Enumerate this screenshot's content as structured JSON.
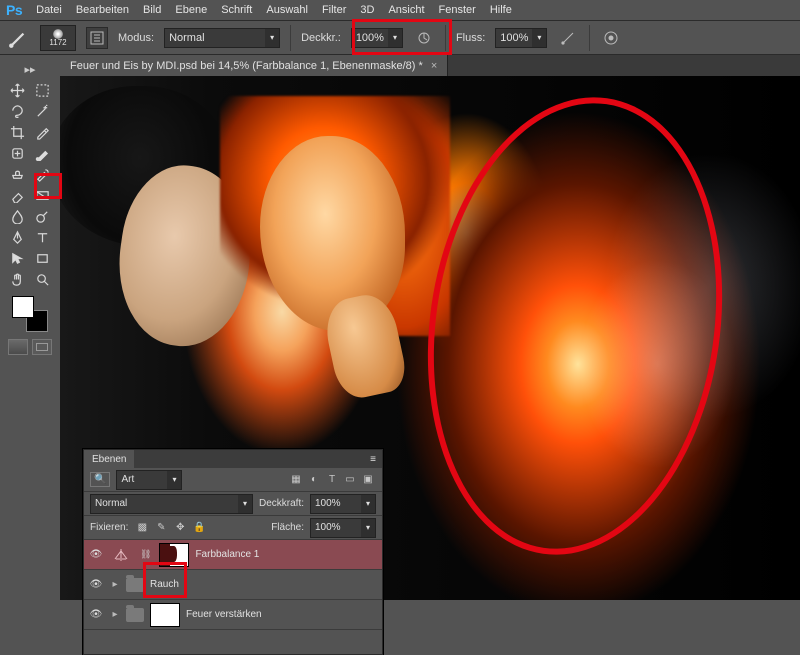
{
  "menu": {
    "items": [
      "Datei",
      "Bearbeiten",
      "Bild",
      "Ebene",
      "Schrift",
      "Auswahl",
      "Filter",
      "3D",
      "Ansicht",
      "Fenster",
      "Hilfe"
    ]
  },
  "options": {
    "brush_size": "1172",
    "mode_label": "Modus:",
    "mode_value": "Normal",
    "opacity_label": "Deckkr.:",
    "opacity_value": "100%",
    "flow_label": "Fluss:",
    "flow_value": "100%"
  },
  "document": {
    "tab_title": "Feuer und Eis by MDI.psd bei 14,5% (Farbbalance 1, Ebenenmaske/8) *"
  },
  "layers_panel": {
    "tab": "Ebenen",
    "filter_label": "Art",
    "blend_mode": "Normal",
    "opacity_label": "Deckkraft:",
    "opacity_value": "100%",
    "lock_label": "Fixieren:",
    "fill_label": "Fläche:",
    "fill_value": "100%",
    "layers": [
      {
        "name": "Farbbalance 1"
      },
      {
        "name": "Rauch"
      },
      {
        "name": "Feuer verstärken"
      }
    ]
  }
}
